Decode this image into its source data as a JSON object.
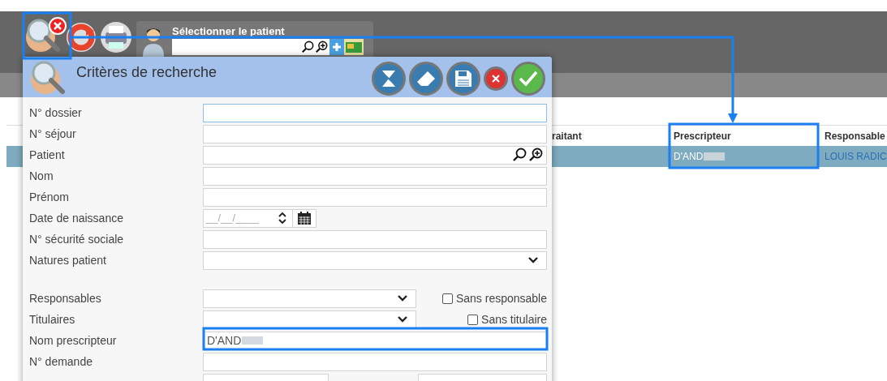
{
  "toolbar": {
    "patient_selector": {
      "title": "Sélectionner le patient"
    }
  },
  "table": {
    "columns": [
      "raitant",
      "Prescripteur",
      "Responsable"
    ],
    "rows": [
      {
        "selected": true,
        "prescripteur": "D'AND",
        "responsable": "LOUIS RADIC"
      }
    ]
  },
  "dialog": {
    "title": "Critères de recherche",
    "fields": [
      {
        "kind": "text",
        "label": "N° dossier",
        "focused": true
      },
      {
        "kind": "text",
        "label": "N° séjour",
        "focused": false
      },
      {
        "kind": "search",
        "label": "Patient",
        "focused": false
      },
      {
        "kind": "text",
        "label": "Nom",
        "focused": false
      },
      {
        "kind": "text",
        "label": "Prénom",
        "focused": false
      },
      {
        "kind": "date",
        "label": "Date de naissance",
        "placeholder": "__/__/____"
      },
      {
        "kind": "text",
        "label": "N° sécurité sociale",
        "focused": false
      },
      {
        "kind": "select",
        "label": "Natures patient"
      },
      {
        "kind": "spacer"
      },
      {
        "kind": "select_check",
        "label": "Responsables",
        "check_label": "Sans responsable",
        "checked": false
      },
      {
        "kind": "select_check",
        "label": "Titulaires",
        "check_label": "Sans titulaire",
        "checked": false
      },
      {
        "kind": "text",
        "label": "Nom prescripteur",
        "value": "D'AND",
        "focused": false
      },
      {
        "kind": "text",
        "label": "N° demande",
        "focused": false
      },
      {
        "kind": "pair"
      }
    ]
  }
}
